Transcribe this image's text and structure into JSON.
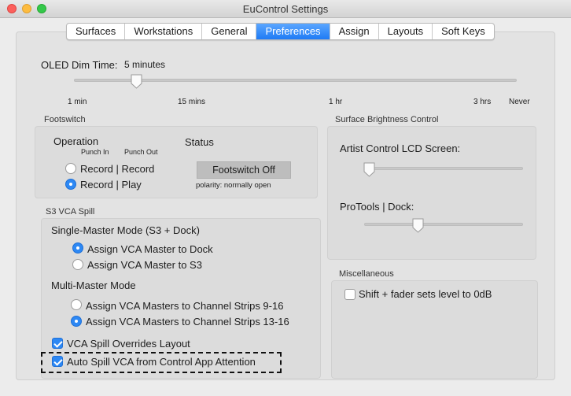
{
  "window": {
    "title": "EuControl Settings"
  },
  "tabs": [
    "Surfaces",
    "Workstations",
    "General",
    "Preferences",
    "Assign",
    "Layouts",
    "Soft Keys"
  ],
  "oled": {
    "label": "OLED Dim Time:",
    "value": "5 minutes",
    "ticks": [
      "1 min",
      "15 mins",
      "1 hr",
      "3 hrs",
      "Never"
    ]
  },
  "footswitch": {
    "title": "Footswitch",
    "operation_label": "Operation",
    "punch_in": "Punch In",
    "punch_out": "Punch Out",
    "status_label": "Status",
    "options": [
      {
        "label": "Record | Record",
        "selected": false
      },
      {
        "label": "Record | Play",
        "selected": true
      }
    ],
    "status_button": "Footswitch Off",
    "polarity": "polarity: normally open"
  },
  "brightness": {
    "title": "Surface Brightness Control",
    "artist_label": "Artist Control LCD Screen:",
    "protools_label": "ProTools | Dock:"
  },
  "vca_spill": {
    "title": "S3 VCA Spill",
    "single_master_heading": "Single-Master Mode (S3 + Dock)",
    "single_options": [
      {
        "label": "Assign VCA Master to Dock",
        "selected": true
      },
      {
        "label": "Assign VCA Master to S3",
        "selected": false
      }
    ],
    "multi_master_heading": "Multi-Master Mode",
    "multi_options": [
      {
        "label": "Assign VCA Masters to Channel Strips 9-16",
        "selected": false
      },
      {
        "label": "Assign VCA Masters to Channel Strips 13-16",
        "selected": true
      }
    ],
    "overrides_layout": {
      "label": "VCA Spill Overrides Layout",
      "checked": true
    },
    "auto_spill": {
      "label": "Auto Spill VCA from Control App Attention",
      "checked": true
    }
  },
  "misc": {
    "title": "Miscellaneous",
    "shift_fader": {
      "label": "Shift + fader sets level to 0dB",
      "checked": false
    }
  },
  "colors": {
    "accent": "#2d88f4",
    "active_tab": "#1e7bf5"
  }
}
